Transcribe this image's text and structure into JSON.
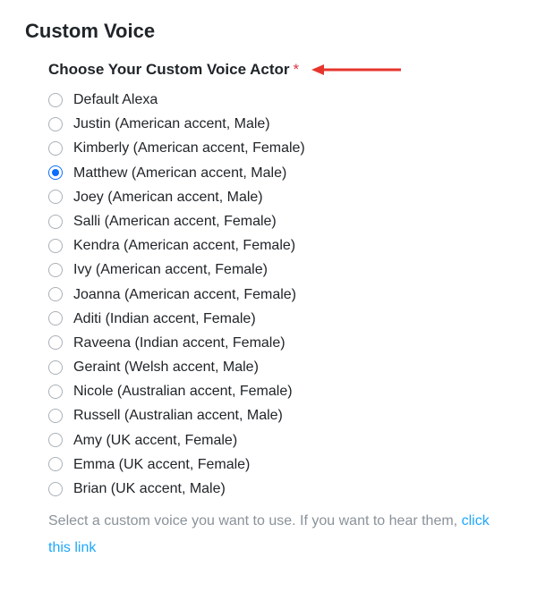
{
  "section": {
    "title": "Custom Voice"
  },
  "form": {
    "label": "Choose Your Custom Voice Actor",
    "required_marker": "*",
    "selected_index": 3,
    "options": [
      {
        "label": "Default Alexa"
      },
      {
        "label": "Justin (American accent, Male)"
      },
      {
        "label": "Kimberly (American accent, Female)"
      },
      {
        "label": "Matthew (American accent, Male)"
      },
      {
        "label": "Joey (American accent, Male)"
      },
      {
        "label": "Salli (American accent, Female)"
      },
      {
        "label": "Kendra (American accent, Female)"
      },
      {
        "label": "Ivy (American accent, Female)"
      },
      {
        "label": "Joanna (American accent, Female)"
      },
      {
        "label": "Aditi (Indian accent, Female)"
      },
      {
        "label": "Raveena (Indian accent, Female)"
      },
      {
        "label": "Geraint (Welsh accent, Male)"
      },
      {
        "label": "Nicole (Australian accent, Female)"
      },
      {
        "label": "Russell (Australian accent, Male)"
      },
      {
        "label": "Amy (UK accent, Female)"
      },
      {
        "label": "Emma (UK accent, Female)"
      },
      {
        "label": "Brian (UK accent, Male)"
      }
    ],
    "help_text": "Select a custom voice you want to use. If you want to hear them, ",
    "help_link_text": "click this link"
  },
  "annotation": {
    "arrow_color": "#e7352c"
  }
}
